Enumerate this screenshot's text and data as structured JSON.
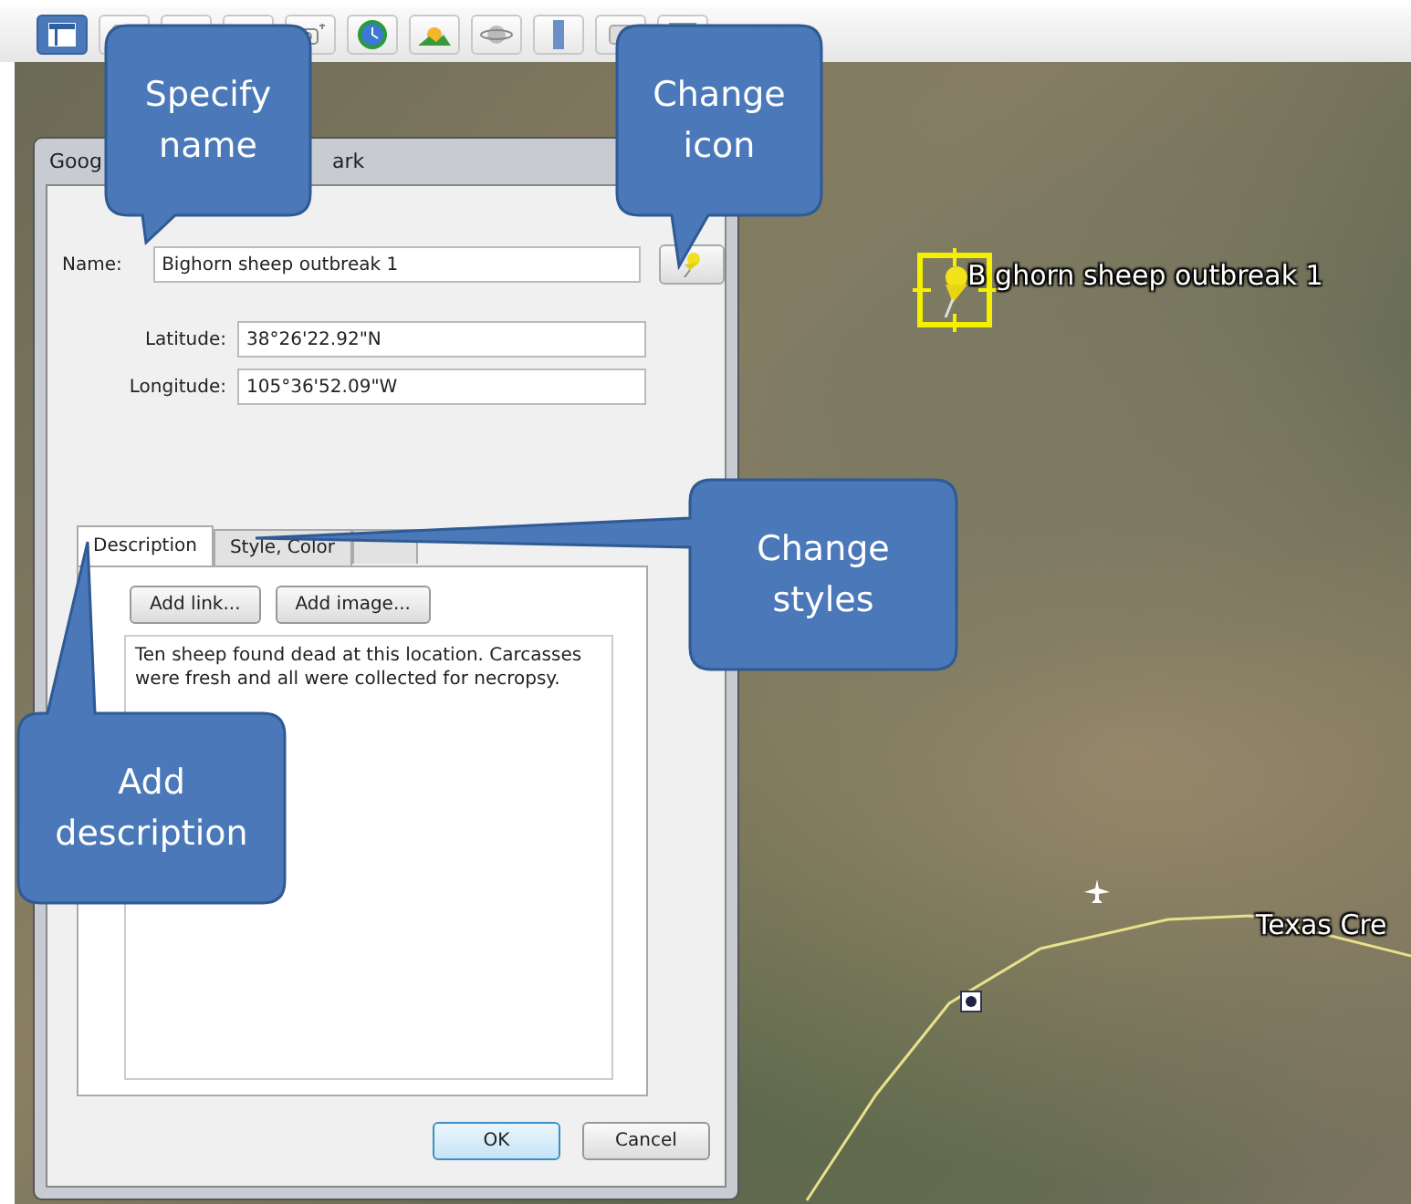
{
  "toolbar": {
    "buttons": [
      {
        "kind": "sidebar",
        "selected": true
      },
      {
        "kind": "plain",
        "selected": false
      },
      {
        "kind": "plain",
        "selected": false
      },
      {
        "kind": "plain",
        "selected": false
      },
      {
        "kind": "camera",
        "selected": false
      },
      {
        "kind": "clock",
        "selected": false
      },
      {
        "kind": "sun",
        "selected": false
      },
      {
        "kind": "planet",
        "selected": false
      },
      {
        "kind": "ruler",
        "selected": false
      },
      {
        "kind": "plain",
        "selected": false
      },
      {
        "kind": "map",
        "selected": false
      }
    ]
  },
  "dialog": {
    "title_parts": [
      "Goog",
      "ark"
    ],
    "name": {
      "label": "Name:",
      "value": "Bighorn sheep outbreak 1"
    },
    "coords": [
      {
        "label": "Latitude:",
        "value": "38°26'22.92\"N"
      },
      {
        "label": "Longitude:",
        "value": "105°36'52.09\"W"
      }
    ],
    "tabs": [
      {
        "label": "Description",
        "selected": true
      },
      {
        "label": "Style, Color",
        "selected": false
      }
    ],
    "tab_buttons": [
      "Add link...",
      "Add image..."
    ],
    "description": "Ten sheep found dead at this location.  Carcasses were fresh and all were collected for necropsy.",
    "buttons": [
      {
        "label": "OK",
        "default": true
      },
      {
        "label": "Cancel",
        "default": false
      }
    ]
  },
  "map": {
    "placemark_label": "B ghorn sheep outbreak 1",
    "place_label": "Texas Cre"
  },
  "callouts": [
    "Specify name",
    "Change icon",
    "Change styles",
    "Add description"
  ]
}
